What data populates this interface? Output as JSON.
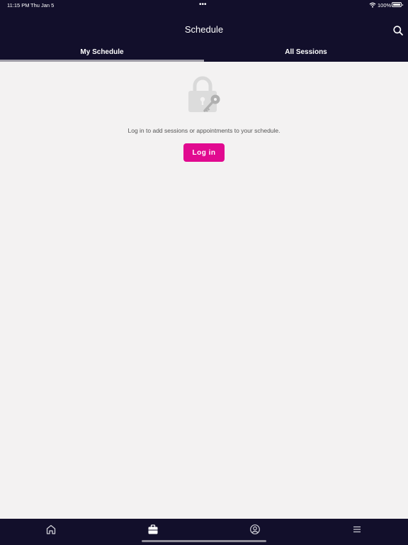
{
  "status_bar": {
    "time": "11:15 PM",
    "date": "Thu Jan 5",
    "dots": "•••",
    "battery": "100%"
  },
  "header": {
    "title": "Schedule"
  },
  "tabs": [
    {
      "label": "My Schedule",
      "selected": true
    },
    {
      "label": "All Sessions",
      "selected": false
    }
  ],
  "main": {
    "message": "Log in to add sessions or appointments to your schedule.",
    "login_label": "Log in"
  },
  "tab_bar": {
    "items": [
      "home-icon",
      "briefcase-icon",
      "profile-icon",
      "menu-icon"
    ]
  },
  "colors": {
    "nav_bg": "#120f2b",
    "accent": "#e10a90",
    "content_bg": "#f3f2f2"
  }
}
